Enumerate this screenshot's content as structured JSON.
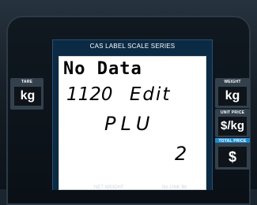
{
  "header": {
    "title": "CAS LABEL SCALE SERIES"
  },
  "lcd": {
    "line1": "No Data",
    "line2_num": "1120",
    "line2_word": "Edit",
    "line3": "PLU",
    "line4": "2"
  },
  "left_panel": {
    "label": "TARE",
    "unit": "kg"
  },
  "right_panel": {
    "weight_label": "WEIGHT",
    "weight_unit": "kg",
    "unit_price_label": "UNIT PRICE",
    "unit_price_unit": "$/kg",
    "total_price_label": "TOTAL PRICE",
    "total_price_unit": "$"
  },
  "footer": {
    "left": "NET WEIGHT",
    "right": "No LINK   Bk"
  },
  "colors": {
    "display_frame": "#0b2a44",
    "lcd_bg": "#ffffff",
    "accent_blue": "#1f8bcf"
  }
}
